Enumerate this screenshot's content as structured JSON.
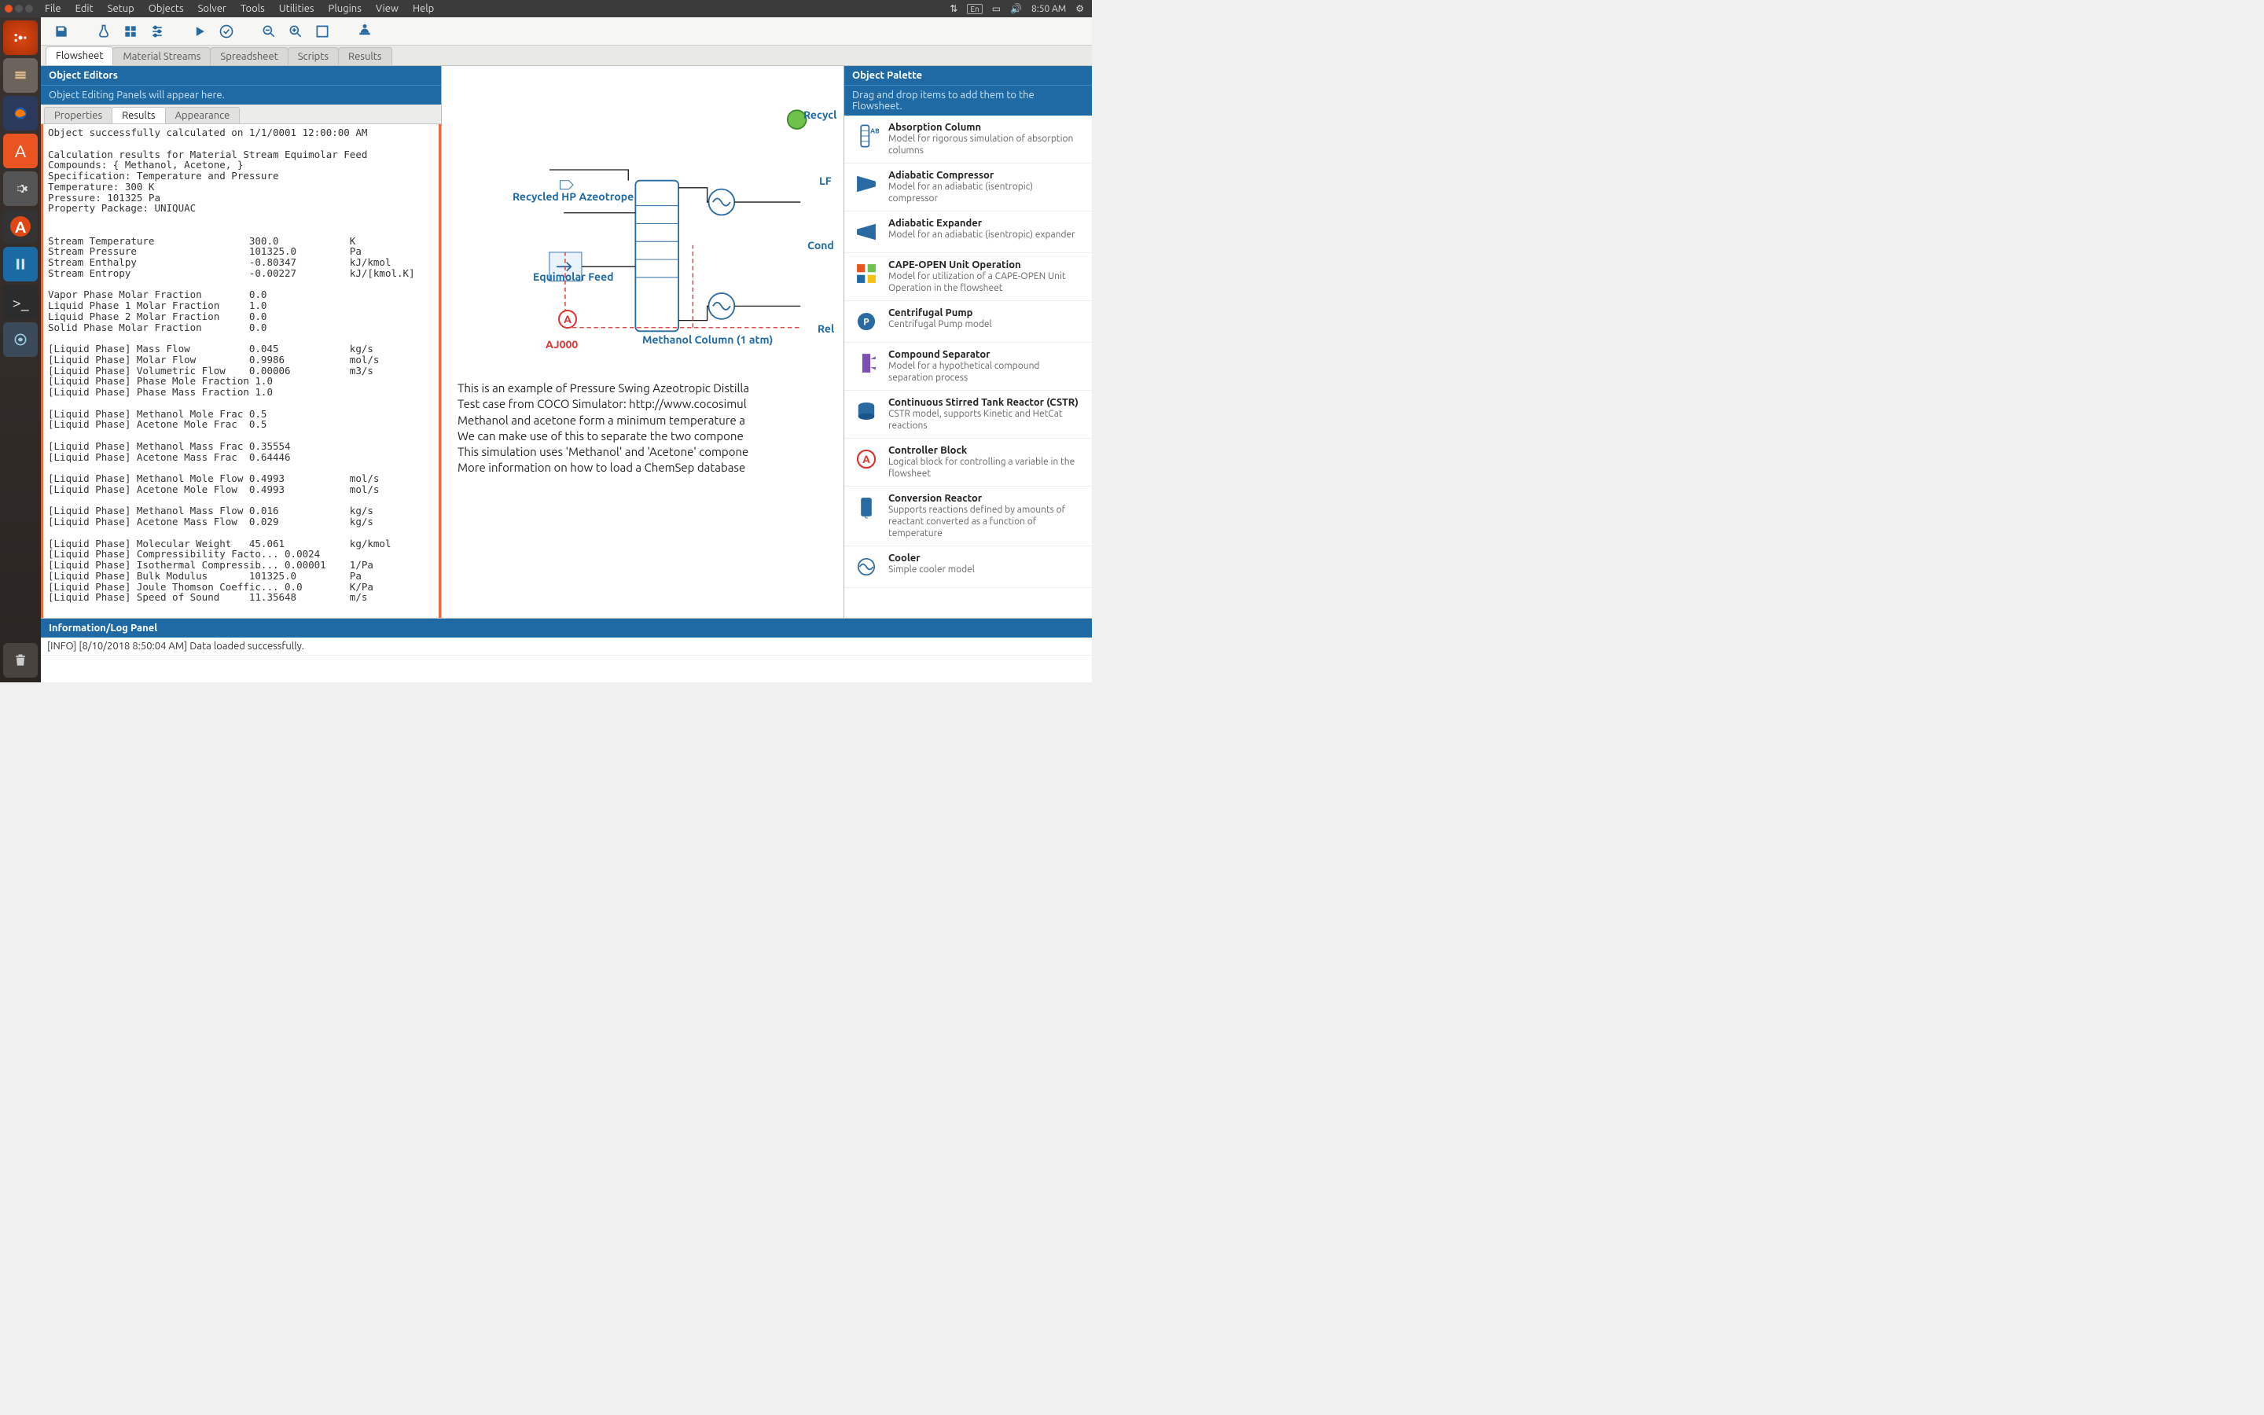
{
  "sys": {
    "menus": [
      "File",
      "Edit",
      "Setup",
      "Objects",
      "Solver",
      "Tools",
      "Utilities",
      "Plugins",
      "View",
      "Help"
    ],
    "tray": {
      "lang": "En",
      "time": "8:50 AM"
    }
  },
  "toolbar_icons": [
    "save",
    "flask",
    "grid",
    "sliders",
    "play",
    "check",
    "zoom-out",
    "zoom-in",
    "fit",
    "incognito"
  ],
  "doc_tabs": [
    "Flowsheet",
    "Material Streams",
    "Spreadsheet",
    "Scripts",
    "Results"
  ],
  "doc_tab_active": 0,
  "left": {
    "title": "Object Editors",
    "subtitle": "Object Editing Panels will appear here.",
    "inner_tabs": [
      "Properties",
      "Results",
      "Appearance"
    ],
    "inner_active": 1,
    "results_text": "Object successfully calculated on 1/1/0001 12:00:00 AM\n\nCalculation results for Material Stream Equimolar Feed\nCompounds: { Methanol, Acetone, }\nSpecification: Temperature and Pressure\nTemperature: 300 K\nPressure: 101325 Pa\nProperty Package: UNIQUAC\n\n\nStream Temperature                300.0            K\nStream Pressure                   101325.0         Pa\nStream Enthalpy                   -0.80347         kJ/kmol\nStream Entropy                    -0.00227         kJ/[kmol.K]\n\nVapor Phase Molar Fraction        0.0\nLiquid Phase 1 Molar Fraction     1.0\nLiquid Phase 2 Molar Fraction     0.0\nSolid Phase Molar Fraction        0.0\n\n[Liquid Phase] Mass Flow          0.045            kg/s\n[Liquid Phase] Molar Flow         0.9986           mol/s\n[Liquid Phase] Volumetric Flow    0.00006          m3/s\n[Liquid Phase] Phase Mole Fraction 1.0\n[Liquid Phase] Phase Mass Fraction 1.0\n\n[Liquid Phase] Methanol Mole Frac 0.5\n[Liquid Phase] Acetone Mole Frac  0.5\n\n[Liquid Phase] Methanol Mass Frac 0.35554\n[Liquid Phase] Acetone Mass Frac  0.64446\n\n[Liquid Phase] Methanol Mole Flow 0.4993           mol/s\n[Liquid Phase] Acetone Mole Flow  0.4993           mol/s\n\n[Liquid Phase] Methanol Mass Flow 0.016            kg/s\n[Liquid Phase] Acetone Mass Flow  0.029            kg/s\n\n[Liquid Phase] Molecular Weight   45.061           kg/kmol\n[Liquid Phase] Compressibility Facto... 0.0024\n[Liquid Phase] Isothermal Compressib... 0.00001    1/Pa\n[Liquid Phase] Bulk Modulus       101325.0         Pa\n[Liquid Phase] Joule Thomson Coeffic... 0.0        K/Pa\n[Liquid Phase] Speed of Sound     11.35648         m/s"
  },
  "flowsheet": {
    "labels": {
      "recycle_top": "Recycl",
      "recycled_hp": "Recycled HP Azeotrope",
      "lp": "LF",
      "equimolar": "Equimolar Feed",
      "cond": "Cond",
      "aj000": "AJ000",
      "column": "Methanol Column (1 atm)",
      "rel": "Rel"
    },
    "desc_lines": [
      "This is an example of Pressure Swing Azeotropic Distilla",
      "Test case from COCO Simulator: http://www.cocosimul",
      "Methanol and acetone form a minimum temperature a",
      "We can make use of this to separate the two compone",
      "This simulation uses 'Methanol' and 'Acetone' compone",
      "More information on how to load a ChemSep database"
    ]
  },
  "right": {
    "title": "Object Palette",
    "subtitle": "Drag and drop items to add them to the Flowsheet.",
    "items": [
      {
        "name": "Absorption Column",
        "desc": "Model for rigorous simulation of absorption columns",
        "icon": "abs-column"
      },
      {
        "name": "Adiabatic Compressor",
        "desc": "Model for an adiabatic (isentropic) compressor",
        "icon": "compressor"
      },
      {
        "name": "Adiabatic Expander",
        "desc": "Model for an adiabatic (isentropic) expander",
        "icon": "expander"
      },
      {
        "name": "CAPE-OPEN Unit Operation",
        "desc": "Model for utilization of a CAPE-OPEN Unit Operation in the flowsheet",
        "icon": "cape-open"
      },
      {
        "name": "Centrifugal Pump",
        "desc": "Centrifugal Pump model",
        "icon": "pump"
      },
      {
        "name": "Compound Separator",
        "desc": "Model for a hypothetical compound separation process",
        "icon": "separator"
      },
      {
        "name": "Continuous Stirred Tank Reactor (CSTR)",
        "desc": "CSTR model, supports Kinetic and HetCat reactions",
        "icon": "cstr"
      },
      {
        "name": "Controller Block",
        "desc": "Logical block for controlling a variable in the flowsheet",
        "icon": "controller"
      },
      {
        "name": "Conversion Reactor",
        "desc": "Supports reactions defined by amounts of reactant converted as a function of temperature",
        "icon": "conv-reactor"
      },
      {
        "name": "Cooler",
        "desc": "Simple cooler model",
        "icon": "cooler"
      }
    ]
  },
  "log": {
    "title": "Information/Log Panel",
    "entry": "[INFO] [8/10/2018 8:50:04 AM] Data loaded successfully."
  }
}
